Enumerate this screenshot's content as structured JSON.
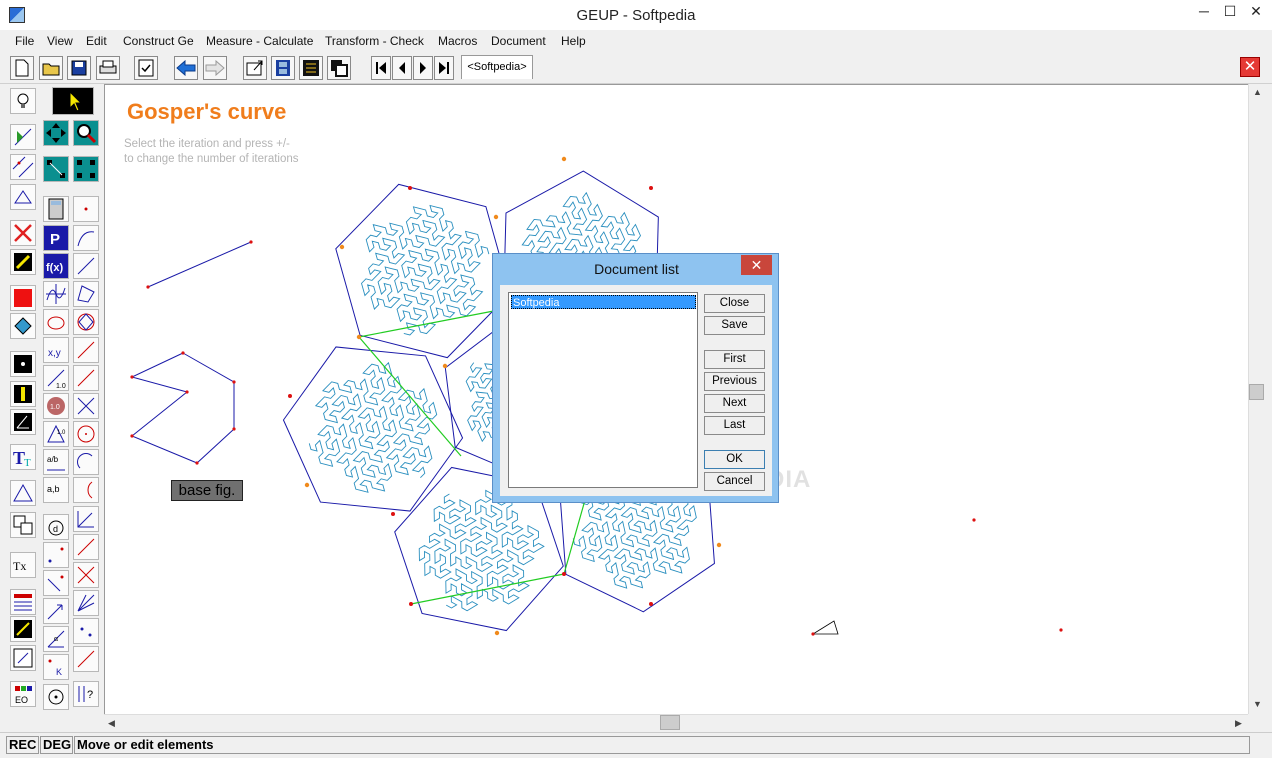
{
  "window": {
    "title": "GEUP - Softpedia",
    "minimize": "─",
    "maximize": "☐",
    "close": "✕"
  },
  "menu": [
    "File",
    "View",
    "Edit",
    "Construct Ge",
    "Measure - Calculate",
    "Transform - Check",
    "Macros",
    "Document",
    "Help"
  ],
  "toolbar": {
    "doc_tab": "<Softpedia>",
    "close_x": "✕"
  },
  "canvas": {
    "heading": "Gosper's curve",
    "hint_line1": "Select the iteration and press +/-",
    "hint_line2": "to change the number of iterations",
    "base_label": "base fig."
  },
  "dialog": {
    "title": "Document list",
    "close": "✕",
    "items": [
      "Softpedia"
    ],
    "buttons": {
      "close": "Close",
      "save": "Save",
      "first": "First",
      "previous": "Previous",
      "next": "Next",
      "last": "Last",
      "ok": "OK",
      "cancel": "Cancel"
    }
  },
  "watermark": "SOFTPEDIA",
  "status": {
    "rec": "REC",
    "deg": "DEG",
    "message": "Move or edit elements"
  },
  "colors": {
    "heading": "#f07d1c",
    "hexagon": "#1a1aa8",
    "curve": "#2a8fbf",
    "joins": "#22cc22",
    "point_red": "#dd1111",
    "point_orange": "#f08a1c"
  }
}
